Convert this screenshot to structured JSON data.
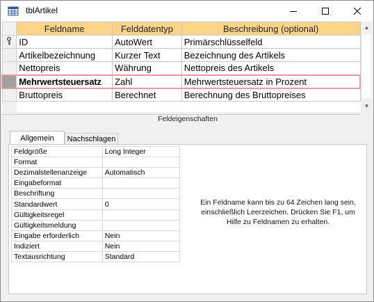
{
  "window": {
    "title": "tblArtikel"
  },
  "grid": {
    "headers": [
      "Feldname",
      "Felddatentyp",
      "Beschreibung (optional)"
    ],
    "rows": [
      {
        "name": "ID",
        "type": "AutoWert",
        "description": "Primärschlüsselfeld",
        "primary_key": true
      },
      {
        "name": "Artikelbezeichnung",
        "type": "Kurzer Text",
        "description": "Bezeichnung des Artikels"
      },
      {
        "name": "Nettopreis",
        "type": "Währung",
        "description": "Nettopreis des Artikels"
      },
      {
        "name": "Mehrwertsteuersatz",
        "type": "Zahl",
        "description": "Mehrwertsteuersatz in Prozent",
        "current": true
      },
      {
        "name": "Bruttopreis",
        "type": "Berechnet",
        "description": "Berechnung des Bruttopreises"
      }
    ]
  },
  "properties_section": {
    "label": "Feldeigenschaften",
    "tabs": [
      "Allgemein",
      "Nachschlagen"
    ],
    "active_tab": "Allgemein",
    "rows": [
      {
        "name": "Feldgröße",
        "value": "Long Integer"
      },
      {
        "name": "Format",
        "value": ""
      },
      {
        "name": "Dezimalstellenanzeige",
        "value": "Automatisch"
      },
      {
        "name": "Eingabeformat",
        "value": ""
      },
      {
        "name": "Beschriftung",
        "value": ""
      },
      {
        "name": "Standardwert",
        "value": "0"
      },
      {
        "name": "Gültigkeitsregel",
        "value": ""
      },
      {
        "name": "Gültigkeitsmeldung",
        "value": ""
      },
      {
        "name": "Eingabe erforderlich",
        "value": "Nein"
      },
      {
        "name": "Indiziert",
        "value": "Nein"
      },
      {
        "name": "Textausrichtung",
        "value": "Standard"
      }
    ],
    "help_text": "Ein Feldname kann bis zu 64 Zeichen lang sein, einschließlich Leerzeichen. Drücken Sie F1, um Hilfe zu Feldnamen zu erhalten."
  },
  "colors": {
    "header_bg": "#fcd488",
    "current_row_border": "#e89ba5"
  }
}
